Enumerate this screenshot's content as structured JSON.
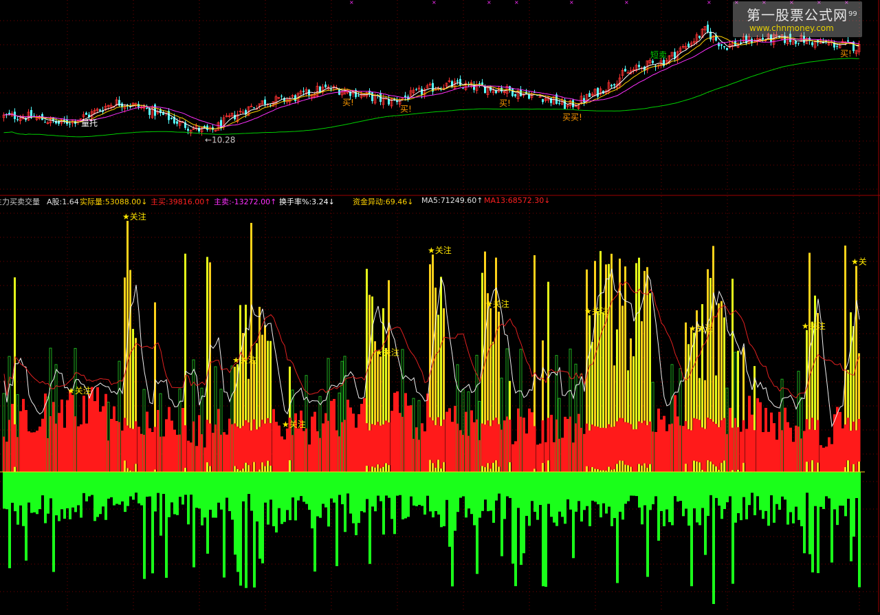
{
  "header": {
    "indicator_name": "主力买卖交量",
    "items": [
      {
        "text": "A股:1.64",
        "color": "#e0e0e0"
      },
      {
        "text": "实际量:53088.00↓",
        "color": "#ffd200"
      },
      {
        "text": "主买:39816.00↑",
        "color": "#ff2020"
      },
      {
        "text": "主卖:-13272.00↑",
        "color": "#ff30ff"
      },
      {
        "text": "换手率%:3.24↓",
        "color": "#ffffff"
      },
      {
        "text": "资金异动:69.46↓",
        "color": "#ffd200"
      },
      {
        "text": "MA5:71249.60↑",
        "color": "#e0e0e0"
      },
      {
        "text": "MA13:68572.30↓",
        "color": "#ff2020"
      }
    ]
  },
  "watermark": {
    "title": "第一股票公式网",
    "subtitle": "www.chnmoney.com"
  },
  "corner_label": "99",
  "annotations": {
    "price": [
      {
        "text": "量托",
        "color": "#ffffff",
        "bar": 30
      },
      {
        "text": "←10.28",
        "color": "#c8c8c8",
        "bar": 75
      },
      {
        "text": "买!",
        "color": "#ff9a00",
        "bar": 125
      },
      {
        "text": "买!",
        "color": "#ff9a00",
        "bar": 146
      },
      {
        "text": "买!",
        "color": "#ff9a00",
        "bar": 182
      },
      {
        "text": "买买!",
        "color": "#ff9a00",
        "bar": 205
      },
      {
        "text": "短卖",
        "color": "#00d000",
        "bar": 237
      },
      {
        "text": "买!",
        "color": "#ff9a00",
        "bar": 306
      }
    ],
    "volume": [
      {
        "text": "★关注",
        "color": "#ffe600",
        "bar": 25
      },
      {
        "text": "★关注",
        "color": "#ffe600",
        "bar": 45
      },
      {
        "text": "★关注",
        "color": "#ffe600",
        "bar": 85
      },
      {
        "text": "★关注",
        "color": "#ffe600",
        "bar": 103
      },
      {
        "text": "★关注",
        "color": "#ffe600",
        "bar": 137
      },
      {
        "text": "★关注",
        "color": "#ffe600",
        "bar": 156
      },
      {
        "text": "★关注",
        "color": "#ffe600",
        "bar": 177
      },
      {
        "text": "★关注",
        "color": "#ffe600",
        "bar": 213
      },
      {
        "text": "★关注",
        "color": "#ffe600",
        "bar": 251
      },
      {
        "text": "★关注",
        "color": "#ffe600",
        "bar": 292
      },
      {
        "text": "★关",
        "color": "#ffe600",
        "bar": 310
      }
    ]
  },
  "colors": {
    "up": "#ff3232",
    "down": "#54ffff",
    "ma5": "#ffffff",
    "ma10": "#ffd200",
    "ma20": "#ff30ff",
    "ma60": "#00d000",
    "buy": "#ff1a1a",
    "sell": "#1aff1a",
    "strong": "#ffd21a",
    "watch": "#e6ff1a",
    "grid": "#7a0000"
  },
  "chart_data": [
    {
      "type": "candlestick",
      "title": "",
      "series": [
        {
          "name": "K线",
          "values": []
        },
        {
          "name": "MA5",
          "values": []
        },
        {
          "name": "MA10",
          "values": []
        },
        {
          "name": "MA20",
          "values": []
        },
        {
          "name": "MA60",
          "values": []
        }
      ],
      "bars": 312,
      "price_low_marker": 10.28,
      "trend": [
        [
          0,
          12.2
        ],
        [
          20,
          11.9
        ],
        [
          40,
          12.8
        ],
        [
          60,
          12.2
        ],
        [
          75,
          11.5
        ],
        [
          95,
          12.9
        ],
        [
          115,
          13.4
        ],
        [
          140,
          13.0
        ],
        [
          160,
          13.5
        ],
        [
          180,
          13.6
        ],
        [
          205,
          12.6
        ],
        [
          225,
          14.1
        ],
        [
          240,
          14.6
        ],
        [
          255,
          16.2
        ],
        [
          262,
          15.4
        ],
        [
          290,
          15.8
        ],
        [
          311,
          15.2
        ]
      ],
      "grid": true
    },
    {
      "type": "bar",
      "title": "",
      "series": [
        {
          "name": "主买",
          "values": []
        },
        {
          "name": "主卖",
          "values": []
        },
        {
          "name": "MA5",
          "values": []
        },
        {
          "name": "MA13",
          "values": []
        }
      ],
      "bars": 312,
      "grid": true
    }
  ]
}
